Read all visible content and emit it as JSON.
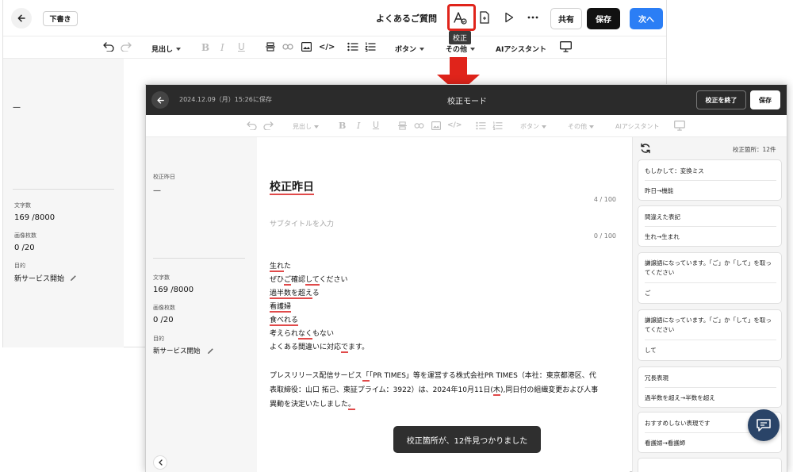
{
  "back_editor": {
    "draft_label": "下書き",
    "title": "よくあるご質問",
    "tooltip": "校正",
    "share_label": "共有",
    "save_label": "保存",
    "next_label": "次へ",
    "toolbar": {
      "heading": "見出し",
      "button": "ボタン",
      "other": "その他",
      "ai": "AIアシスタント"
    },
    "sidebar": {
      "dash": "—",
      "char_label": "文字数",
      "char_value": "169 /8000",
      "image_label": "画像枚数",
      "image_value": "0 /20",
      "purpose_label": "目的",
      "purpose_value": "新サービス開始"
    }
  },
  "front_editor": {
    "saved_text": "2024.12.09（月）15:26に保存",
    "mode_title": "校正モード",
    "end_label": "校正を終了",
    "save_label": "保存",
    "toolbar": {
      "heading": "見出し",
      "button": "ボタン",
      "other": "その他",
      "ai": "AIアシスタント"
    },
    "sidebar": {
      "title_label": "校正昨日",
      "dash": "—",
      "char_label": "文字数",
      "char_value": "169 /8000",
      "image_label": "画像枚数",
      "image_value": "0 /20",
      "purpose_label": "目的",
      "purpose_value": "新サービス開始"
    },
    "doc": {
      "title": "校正昨日",
      "title_count": "4 / 100",
      "subtitle_placeholder": "サブタイトルを入力",
      "subtitle_count": "0 / 100",
      "lines": [
        {
          "pre": "",
          "err": "生れ",
          "post": "た"
        },
        {
          "pre": "ぜひ",
          "err": "ご",
          "post": "確認",
          "err2": "して",
          "post2": "ください"
        },
        {
          "pre": "",
          "err": "過半数を超え",
          "post": "る"
        },
        {
          "pre": "",
          "err": "看護婦",
          "post": ""
        },
        {
          "pre": "",
          "err": "食べれる",
          "post": ""
        },
        {
          "pre": "考えられ",
          "err": "なく",
          "post": "もない"
        },
        {
          "pre": "よくある間違いに対応",
          "err": "で",
          "post": "ます。"
        }
      ],
      "para_line1_a": "プレスリリース配信サービス",
      "para_line1_err": "「",
      "para_line1_b": "「PR TIMES」等を運営する株式会社PR TIMES（本社：東京都港区、代",
      "para_line2_a": "表取締役：山口 拓己、東証プライム：3922）は、2024年10月11日(",
      "para_line2_err": "木",
      "para_line2_b": "),同日付の組織変更および人事",
      "para_line3_a": "異動を決定いたしました",
      "para_line3_err": "。"
    },
    "toast": "校正箇所が、12件見つかりました",
    "panel": {
      "count_label": "校正箇所：12件",
      "cards": [
        {
          "title": "もしかして：変換ミス",
          "suggestion": "昨日→機能"
        },
        {
          "title": "間違えた表記",
          "suggestion": "生れ→生まれ"
        },
        {
          "title": "謙譲語になっています。「ご」か「して」を取ってください",
          "suggestion": "ご"
        },
        {
          "title": "謙譲語になっています。「ご」か「して」を取ってください",
          "suggestion": "して"
        },
        {
          "title": "冗長表現",
          "suggestion": "過半数を超え→半数を超え"
        },
        {
          "title": "おすすめしない表現です",
          "suggestion": "看護婦→看護師"
        }
      ]
    }
  },
  "colors": {
    "accent_red": "#e0241b",
    "next_blue": "#2b7ef5",
    "dark_header": "#2b2b2b",
    "chat_bubble": "#2a4468",
    "error_underline": "#e04a4a"
  },
  "icons": [
    "back-arrow-icon",
    "proofread-icon",
    "document-icon",
    "play-icon",
    "more-icon",
    "undo-icon",
    "redo-icon",
    "bold-icon",
    "italic-icon",
    "underline-icon",
    "divider-icon",
    "link-icon",
    "image-icon",
    "code-icon",
    "bullet-list-icon",
    "numbered-list-icon",
    "preview-icon",
    "edit-icon",
    "refresh-icon",
    "chat-icon"
  ]
}
